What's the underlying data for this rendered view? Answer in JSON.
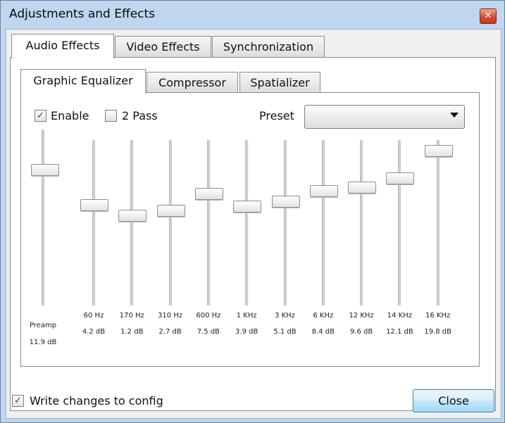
{
  "window": {
    "title": "Adjustments and Effects",
    "close_glyph": "✕"
  },
  "tabs": [
    {
      "label": "Audio Effects",
      "active": true
    },
    {
      "label": "Video Effects",
      "active": false
    },
    {
      "label": "Synchronization",
      "active": false
    }
  ],
  "subtabs": [
    {
      "label": "Graphic Equalizer",
      "active": true
    },
    {
      "label": "Compressor",
      "active": false
    },
    {
      "label": "Spatializer",
      "active": false
    }
  ],
  "equalizer": {
    "enable": {
      "label": "Enable",
      "checked": true
    },
    "two_pass": {
      "label": "2 Pass",
      "checked": false
    },
    "preset": {
      "label": "Preset",
      "value": ""
    },
    "preamp": {
      "label": "Preamp",
      "value": "11.9 dB",
      "level": 0.79
    },
    "bands": [
      {
        "freq": "60 Hz",
        "value": "4.2 dB",
        "level": 0.62
      },
      {
        "freq": "170 Hz",
        "value": "1.2 dB",
        "level": 0.55
      },
      {
        "freq": "310 Hz",
        "value": "2.7 dB",
        "level": 0.58
      },
      {
        "freq": "600 Hz",
        "value": "7.5 dB",
        "level": 0.69
      },
      {
        "freq": "1 KHz",
        "value": "3.9 dB",
        "level": 0.61
      },
      {
        "freq": "3 KHz",
        "value": "5.1 dB",
        "level": 0.64
      },
      {
        "freq": "6 KHz",
        "value": "8.4 dB",
        "level": 0.71
      },
      {
        "freq": "12 KHz",
        "value": "9.6 dB",
        "level": 0.73
      },
      {
        "freq": "14 KHz",
        "value": "12.1 dB",
        "level": 0.79
      },
      {
        "freq": "16 KHz",
        "value": "19.8 dB",
        "level": 0.97
      }
    ]
  },
  "footer": {
    "write_config": {
      "label": "Write changes to config",
      "checked": true
    },
    "close_label": "Close"
  },
  "check_glyph": "✓"
}
